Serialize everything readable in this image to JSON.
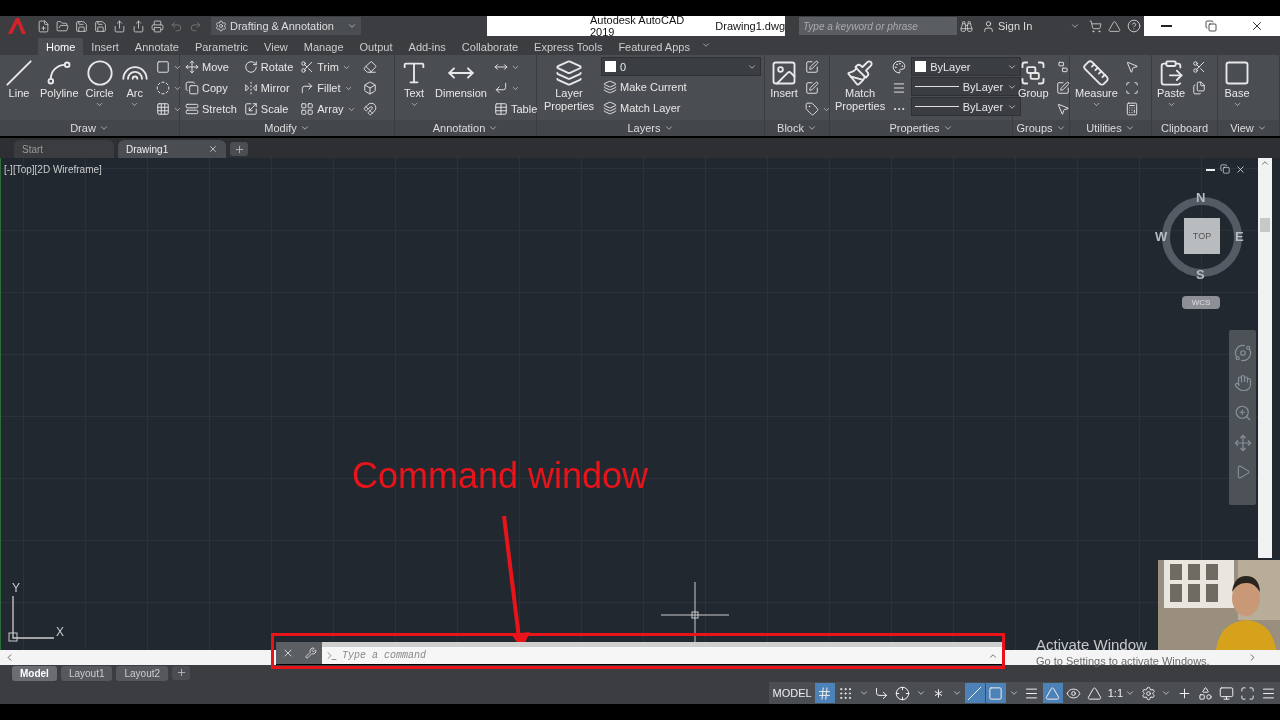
{
  "title_bar": {
    "workspace": "Drafting & Annotation",
    "app_name": "Autodesk AutoCAD 2019",
    "file_name": "Drawing1.dwg",
    "search": {
      "placeholder": "Type a keyword or phrase"
    },
    "account": "Sign In"
  },
  "ribbon_tabs": [
    {
      "label": "Home",
      "selected": true
    },
    {
      "label": "Insert",
      "selected": false
    },
    {
      "label": "Annotate",
      "selected": false
    },
    {
      "label": "Parametric",
      "selected": false
    },
    {
      "label": "View",
      "selected": false
    },
    {
      "label": "Manage",
      "selected": false
    },
    {
      "label": "Output",
      "selected": false
    },
    {
      "label": "Add-ins",
      "selected": false
    },
    {
      "label": "Collaborate",
      "selected": false
    },
    {
      "label": "Express Tools",
      "selected": false
    },
    {
      "label": "Featured Apps",
      "selected": false
    }
  ],
  "panels": [
    {
      "title": "Draw",
      "expandable": true,
      "columns": [
        {
          "kind": "large",
          "label": "Line"
        },
        {
          "kind": "large",
          "label": "Polyline"
        },
        {
          "kind": "large_split",
          "label": "Circle"
        },
        {
          "kind": "large_split",
          "label": "Arc"
        },
        {
          "kind": "stack",
          "rows": [
            {
              "kind": "icon_split"
            },
            {
              "kind": "icon_split"
            },
            {
              "kind": "icon_split"
            }
          ]
        }
      ]
    },
    {
      "title": "Modify",
      "expandable": true,
      "columns": [
        {
          "kind": "stack",
          "rows": [
            {
              "kind": "small",
              "label": "Move"
            },
            {
              "kind": "small",
              "label": "Copy"
            },
            {
              "kind": "small",
              "label": "Stretch"
            }
          ]
        },
        {
          "kind": "stack",
          "rows": [
            {
              "kind": "small",
              "label": "Rotate"
            },
            {
              "kind": "small",
              "label": "Mirror"
            },
            {
              "kind": "small",
              "label": "Scale"
            }
          ]
        },
        {
          "kind": "stack",
          "rows": [
            {
              "kind": "small_split",
              "label": "Trim"
            },
            {
              "kind": "small_split",
              "label": "Fillet"
            },
            {
              "kind": "small_split",
              "label": "Array"
            }
          ]
        },
        {
          "kind": "stack",
          "rows": [
            {
              "kind": "icon"
            },
            {
              "kind": "icon"
            },
            {
              "kind": "icon"
            }
          ]
        }
      ]
    },
    {
      "title": "Annotation",
      "expandable": true,
      "columns": [
        {
          "kind": "large_split",
          "label": "Text"
        },
        {
          "kind": "large",
          "label": "Dimension"
        },
        {
          "kind": "stack",
          "rows": [
            {
              "kind": "icon_split"
            },
            {
              "kind": "icon_split"
            },
            {
              "kind": "small",
              "label": "Table"
            }
          ]
        }
      ]
    },
    {
      "title": "Layers",
      "expandable": true,
      "columns": [
        {
          "kind": "large",
          "label": "Layer Properties"
        },
        {
          "kind": "stack",
          "rows": [
            {
              "kind": "select_layer",
              "value": "0"
            },
            {
              "kind": "small",
              "label": "Make Current"
            },
            {
              "kind": "small",
              "label": "Match Layer"
            }
          ]
        }
      ]
    },
    {
      "title": "Block",
      "expandable": true,
      "columns": [
        {
          "kind": "large",
          "label": "Insert"
        },
        {
          "kind": "stack",
          "rows": [
            {
              "kind": "icon"
            },
            {
              "kind": "icon"
            },
            {
              "kind": "icon_split"
            }
          ]
        }
      ]
    },
    {
      "title": "Properties",
      "expandable": true,
      "columns": [
        {
          "kind": "large",
          "label": "Match Properties"
        },
        {
          "kind": "stack",
          "rows": [
            {
              "kind": "icon"
            },
            {
              "kind": "icon"
            },
            {
              "kind": "icon"
            }
          ]
        },
        {
          "kind": "stack",
          "rows": [
            {
              "kind": "select_color",
              "value": "ByLayer"
            },
            {
              "kind": "select_line",
              "value": "ByLayer"
            },
            {
              "kind": "select_line",
              "value": "ByLayer"
            }
          ]
        }
      ]
    },
    {
      "title": "Groups",
      "expandable": true,
      "columns": [
        {
          "kind": "large",
          "label": "Group"
        },
        {
          "kind": "stack",
          "rows": [
            {
              "kind": "icon"
            },
            {
              "kind": "icon"
            },
            {
              "kind": "icon"
            }
          ]
        }
      ]
    },
    {
      "title": "Utilities",
      "expandable": true,
      "columns": [
        {
          "kind": "large_split",
          "label": "Measure"
        },
        {
          "kind": "stack",
          "rows": [
            {
              "kind": "icon"
            },
            {
              "kind": "icon"
            },
            {
              "kind": "icon"
            }
          ]
        }
      ]
    },
    {
      "title": "Clipboard",
      "expandable": false,
      "columns": [
        {
          "kind": "large_split",
          "label": "Paste"
        },
        {
          "kind": "stack",
          "rows": [
            {
              "kind": "icon"
            },
            {
              "kind": "icon"
            }
          ]
        }
      ]
    },
    {
      "title": "View",
      "expandable": true,
      "columns": [
        {
          "kind": "large_split",
          "label": "Base"
        }
      ]
    }
  ],
  "doc_tabs": [
    {
      "label": "Start",
      "selected": false
    },
    {
      "label": "Drawing1",
      "selected": true
    }
  ],
  "viewport": {
    "label": "[-][Top][2D Wireframe]",
    "viewcube": {
      "north": "N",
      "west": "W",
      "east": "E",
      "south": "S",
      "face": "TOP",
      "ucs_menu": "WCS"
    },
    "ucs_axes": {
      "x": "X",
      "y": "Y"
    }
  },
  "annotation": {
    "text": "Command window"
  },
  "command_line": {
    "placeholder": "Type a command"
  },
  "layout_tabs": [
    {
      "label": "Model",
      "selected": true
    },
    {
      "label": "Layout1",
      "selected": false
    },
    {
      "label": "Layout2",
      "selected": false
    }
  ],
  "status_bar": [
    {
      "kind": "label",
      "text": "MODEL"
    },
    {
      "kind": "toggle",
      "on": true
    },
    {
      "kind": "toggle",
      "on": false
    },
    {
      "kind": "caret"
    },
    {
      "kind": "toggle",
      "on": false
    },
    {
      "kind": "toggle",
      "on": false
    },
    {
      "kind": "caret"
    },
    {
      "kind": "toggle",
      "on": false
    },
    {
      "kind": "caret"
    },
    {
      "kind": "toggle",
      "on": true
    },
    {
      "kind": "toggle",
      "on": true
    },
    {
      "kind": "caret"
    },
    {
      "kind": "toggle",
      "on": false
    },
    {
      "kind": "toggle",
      "on": true
    },
    {
      "kind": "toggle",
      "on": false
    },
    {
      "kind": "toggle",
      "on": false
    },
    {
      "kind": "scale",
      "text": "1:1"
    },
    {
      "kind": "button"
    },
    {
      "kind": "caret"
    },
    {
      "kind": "button"
    },
    {
      "kind": "button"
    },
    {
      "kind": "button"
    },
    {
      "kind": "button"
    },
    {
      "kind": "button"
    }
  ],
  "os_notice": {
    "title": "Activate Window",
    "subtitle": "Go to Settings to activate Windows."
  }
}
